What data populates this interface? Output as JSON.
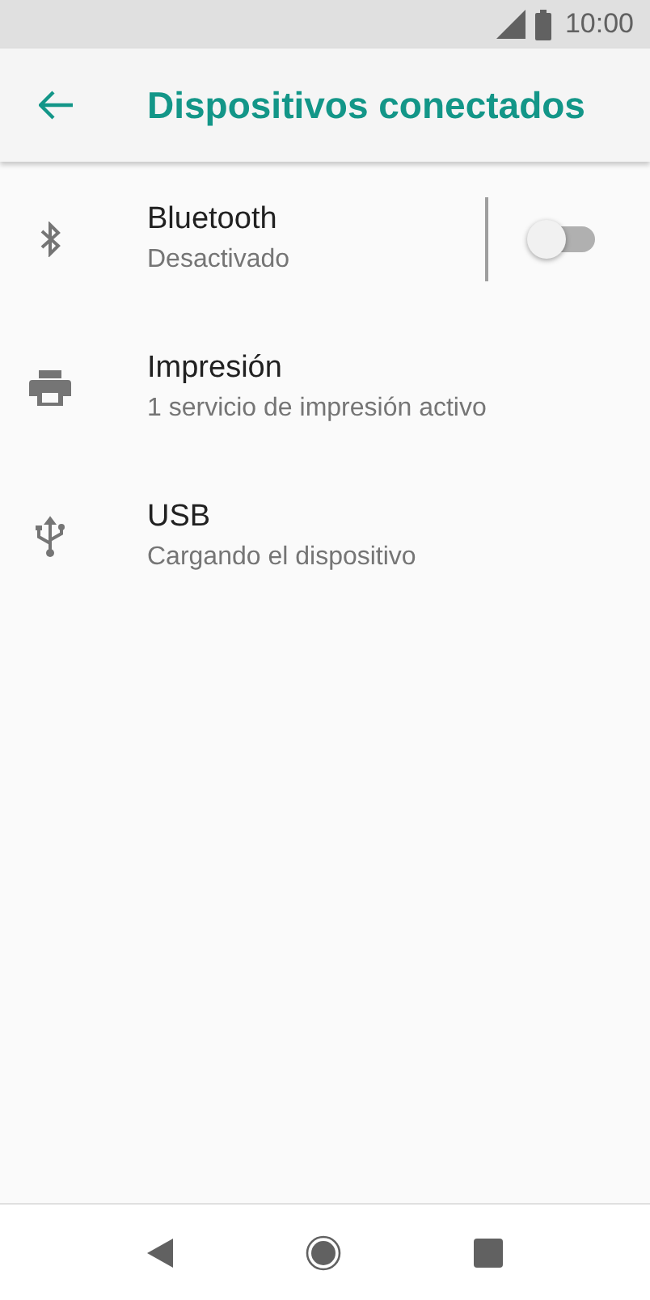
{
  "status_bar": {
    "time": "10:00"
  },
  "app_bar": {
    "title": "Dispositivos conectados"
  },
  "items": [
    {
      "kind": "switch",
      "title": "Bluetooth",
      "subtitle": "Desactivado",
      "on": false
    },
    {
      "kind": "plain",
      "title": "Impresión",
      "subtitle": "1 servicio de impresión activo"
    },
    {
      "kind": "plain",
      "title": "USB",
      "subtitle": "Cargando el dispositivo"
    }
  ]
}
